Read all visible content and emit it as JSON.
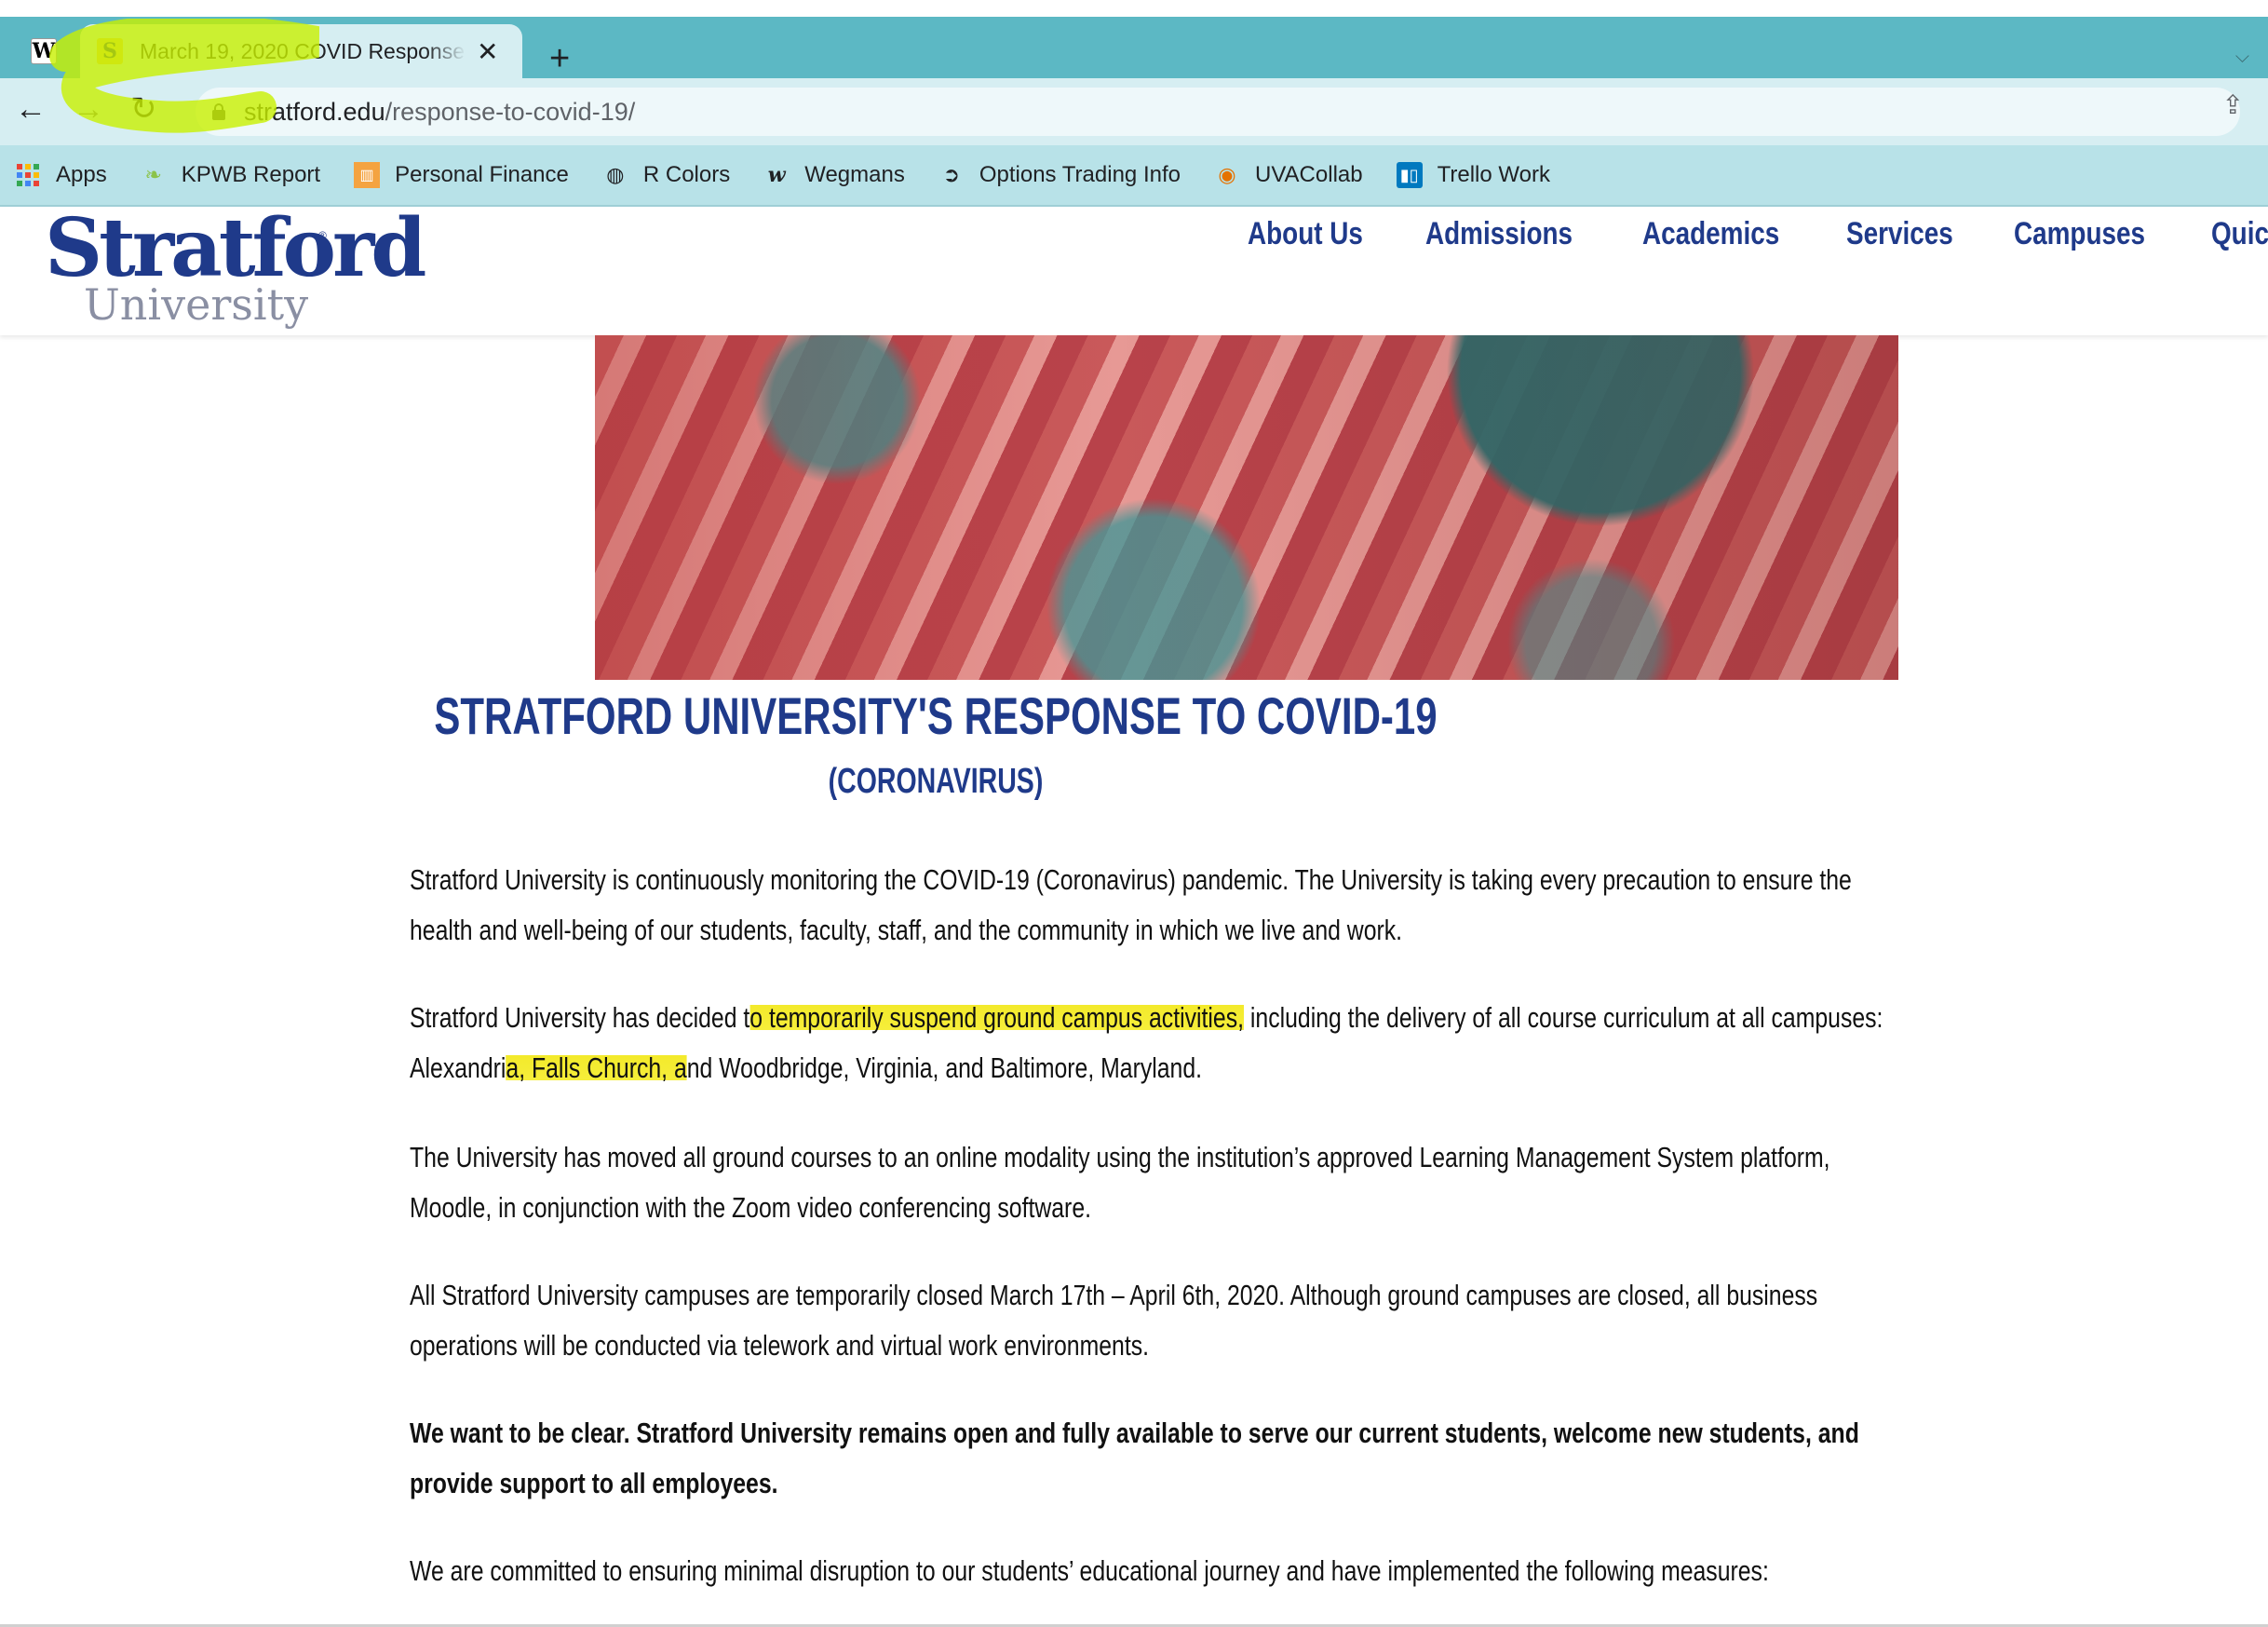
{
  "browser": {
    "tabs": [
      {
        "favicon": "W",
        "title": ""
      },
      {
        "favicon": "S",
        "title": "March 19, 2020 COVID Response"
      }
    ],
    "tab_close": "✕",
    "new_tab": "+",
    "url_domain": "stratford.edu",
    "url_path": "/response-to-covid-19/",
    "bookmarks": [
      {
        "label": "Apps",
        "icon": "apps-grid-icon"
      },
      {
        "label": "KPWB Report",
        "icon": "leaf-icon"
      },
      {
        "label": "Personal Finance",
        "icon": "chart-icon"
      },
      {
        "label": "R Colors",
        "icon": "globe-icon"
      },
      {
        "label": "Wegmans",
        "icon": "w-icon"
      },
      {
        "label": "Options Trading Info",
        "icon": "swirl-icon"
      },
      {
        "label": "UVACollab",
        "icon": "uva-icon"
      },
      {
        "label": "Trello Work",
        "icon": "trello-icon"
      }
    ]
  },
  "site": {
    "logo_main": "Stratford",
    "logo_sub": "University",
    "logo_reg": "®",
    "nav": [
      "About Us",
      "Admissions",
      "Academics",
      "Services",
      "Campuses",
      "Quick Links"
    ],
    "brand_color": "#1f3a8a"
  },
  "content": {
    "title": "STRATFORD UNIVERSITY'S RESPONSE TO COVID-19",
    "subtitle": "(CORONAVIRUS)",
    "p1": "Stratford University is continuously monitoring the COVID-19 (Coronavirus) pandemic. The University is taking every precaution to ensure the health and well-being of our students, faculty, staff, and the community in which we live and work.",
    "p2_a": "Stratford University has decided t",
    "p2_hl1": "o temporarily suspend ground campus activities,",
    "p2_b": " including the delivery of all course curriculum at all campuses: Alexandri",
    "p2_hl2": "a, Falls Church, a",
    "p2_c": "nd Woodbridge, Virginia, and Baltimore, Maryland.",
    "p3": "The University has moved all ground courses to an online modality using the institution’s approved Learning Management System platform, Moodle, in conjunction with the Zoom video conferencing software.",
    "p4": "All Stratford University campuses are temporarily closed March 17th – April 6th, 2020. Although ground campuses are closed, all business operations will be conducted via telework and virtual work environments.",
    "p5": "We want to be clear. Stratford University remains open and fully available to serve our current students, welcome new students, and provide support to all employees.",
    "p6": "We are committed to ensuring minimal disruption to our students’ educational journey and have implemented the following measures:"
  },
  "highlight_color": "#f3ea2b"
}
